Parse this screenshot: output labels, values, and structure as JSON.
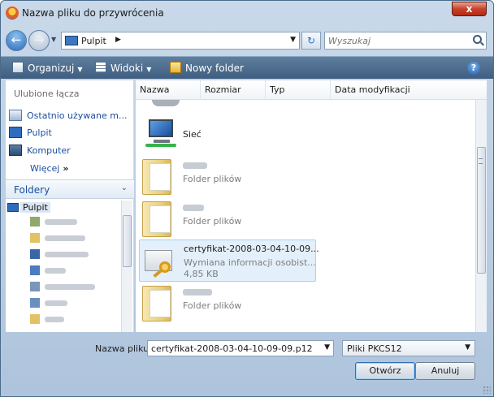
{
  "window": {
    "title": "Nazwa pliku do przywrócenia",
    "close_glyph": "x"
  },
  "address": {
    "location": "Pulpit",
    "separator_glyph": "▶",
    "dropdown_glyph": "▼",
    "refresh_glyph": "↻",
    "search_placeholder": "Wyszukaj"
  },
  "nav_buttons": {
    "back_glyph": "←",
    "forward_glyph": "→",
    "history_glyph": "▼"
  },
  "toolbar": {
    "organize": "Organizuj",
    "views": "Widoki",
    "new_folder": "Nowy folder",
    "arrow_glyph": "▼",
    "help_glyph": "?"
  },
  "sidebar": {
    "favorites_heading": "Ulubione łącza",
    "favorites": [
      {
        "label": "Ostatnio używane m..."
      },
      {
        "label": "Pulpit"
      },
      {
        "label": "Komputer"
      }
    ],
    "more_label": "Więcej",
    "more_glyph": "»",
    "folders_label": "Foldery",
    "folders_chevron": "⌄",
    "tree_root": "Pulpit"
  },
  "columns": {
    "name": "Nazwa",
    "size": "Rozmiar",
    "type": "Typ",
    "date": "Data modyfikacji"
  },
  "items": {
    "network": {
      "name": "Sieć"
    },
    "folder1": {
      "type": "Folder plików"
    },
    "folder2": {
      "type": "Folder plików"
    },
    "cert": {
      "name": "certyfikat-2008-03-04-10-09...",
      "type": "Wymiana informacji osobist...",
      "size": "4,85 KB"
    },
    "folder3": {
      "type": "Folder plików"
    }
  },
  "bottom": {
    "filename_label": "Nazwa pliku:",
    "filename_value": "certyfikat-2008-03-04-10-09-09.p12",
    "filename_dropdown": "▼",
    "filetype": "Pliki PKCS12",
    "filetype_dropdown": "▼",
    "open_button": "Otwórz",
    "cancel_button": "Anuluj"
  },
  "colors": {
    "accent": "#1b4fa0",
    "toolbar": "#4a6a8c",
    "selection": "#e3f0fb"
  }
}
